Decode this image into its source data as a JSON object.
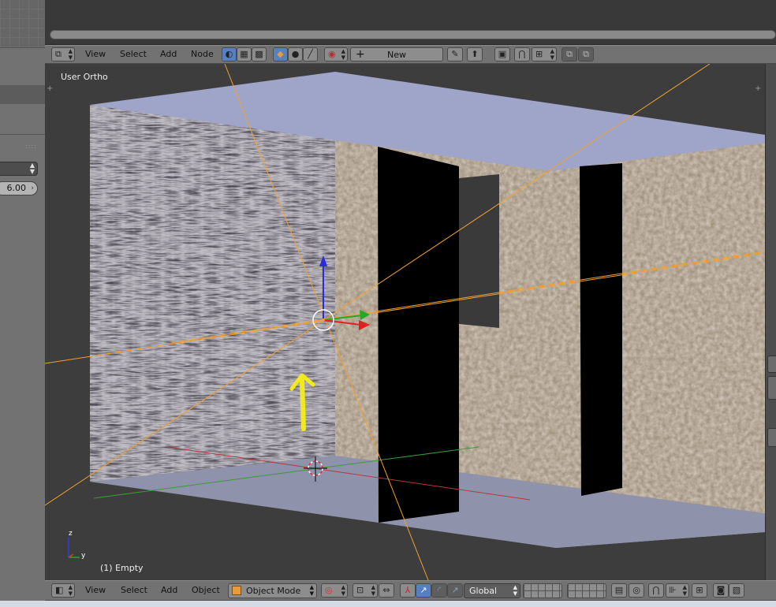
{
  "node_editor_header": {
    "menu": [
      "View",
      "Select",
      "Add",
      "Node"
    ],
    "new_label": "New"
  },
  "viewport": {
    "view_name": "User Ortho",
    "object_name": "(1) Empty",
    "axis_labels": {
      "z": "z",
      "y": "y"
    }
  },
  "view3d_header": {
    "menu": [
      "View",
      "Select",
      "Add",
      "Object"
    ],
    "mode_label": "Object Mode",
    "orientation_label": "Global"
  },
  "properties_panel": {
    "value": "6.00"
  },
  "colors": {
    "header_bg": "#727272",
    "viewport_bg": "#3d3d3d",
    "active_button": "#5680c2",
    "plane_color": "#9ea5c8",
    "selection_orange": "#f0a030",
    "arrow_yellow": "#f2ea1c"
  }
}
